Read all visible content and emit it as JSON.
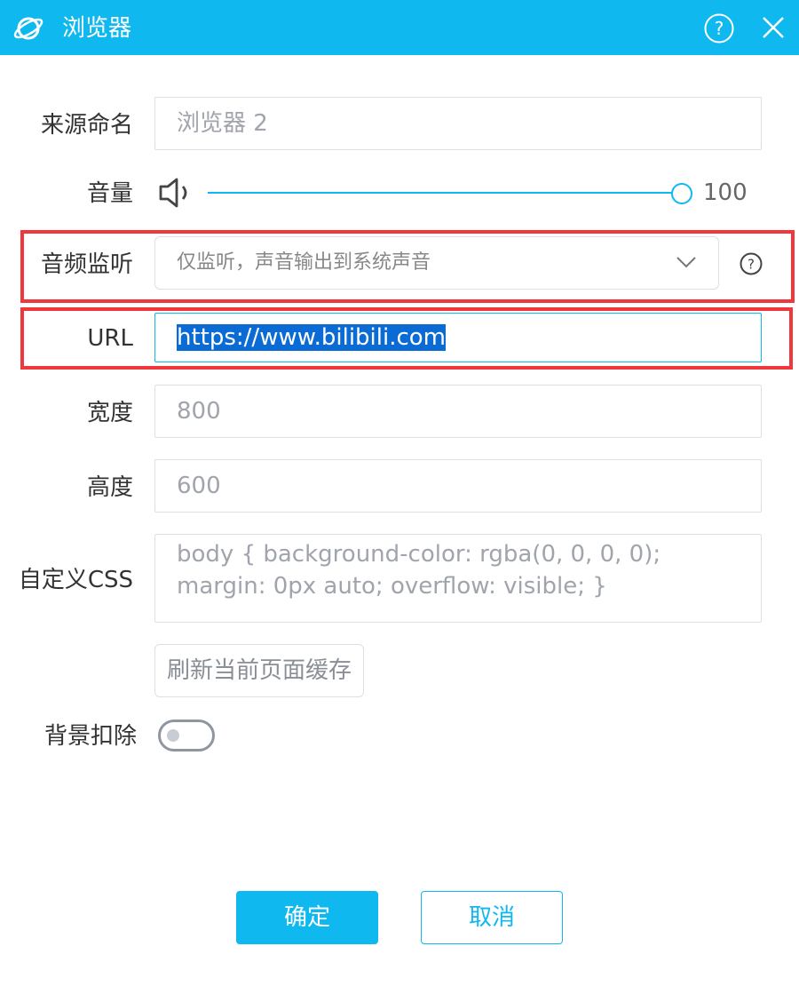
{
  "window": {
    "title": "浏览器",
    "accent": "#10b8f0",
    "icons": [
      "planet-icon",
      "help-circle-icon",
      "close-icon"
    ]
  },
  "form": {
    "source_name": {
      "label": "来源命名",
      "placeholder": "浏览器 2"
    },
    "volume": {
      "label": "音量",
      "value": "100",
      "level": 1.0,
      "icon": "speaker-icon"
    },
    "audio_monitor": {
      "label": "音频监听",
      "selected": "仅监听，声音输出到系统声音",
      "help_icon": "help-circle-icon"
    },
    "url": {
      "label": "URL",
      "value": "https://www.bilibili.com"
    },
    "width": {
      "label": "宽度",
      "value": "800"
    },
    "height": {
      "label": "高度",
      "value": "600"
    },
    "custom_css": {
      "label": "自定义CSS",
      "line1": "body { background-color: rgba(0, 0, 0, 0);",
      "line2": "margin: 0px auto; overflow: visible; }"
    },
    "refresh_cache_button": "刷新当前页面缓存",
    "background_removal": {
      "label": "背景扣除",
      "enabled": false
    }
  },
  "footer": {
    "confirm": "确定",
    "cancel": "取消"
  },
  "highlight_color": "#f0373b"
}
